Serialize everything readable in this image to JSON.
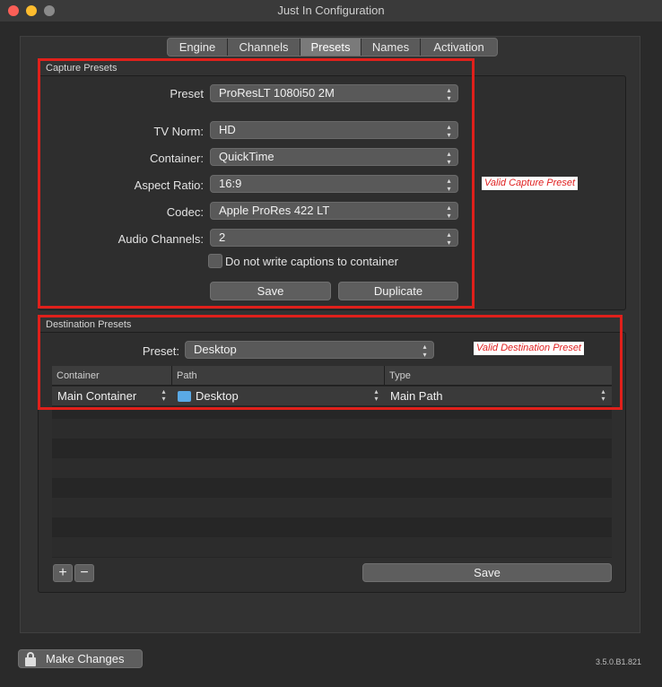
{
  "window": {
    "title": "Just In Configuration",
    "lights": {
      "close": "#fc5f57",
      "minimize": "#fdbc2e",
      "zoom": "#8a8a8a"
    }
  },
  "tabs": [
    {
      "label": "Engine",
      "active": false
    },
    {
      "label": "Channels",
      "active": false
    },
    {
      "label": "Presets",
      "active": true
    },
    {
      "label": "Names",
      "active": false
    },
    {
      "label": "Activation",
      "active": false
    }
  ],
  "capture": {
    "title": "Capture Presets",
    "preset_label": "Preset",
    "preset_value": "ProResLT 1080i50 2M",
    "tvnorm_label": "TV Norm:",
    "tvnorm_value": "HD",
    "container_label": "Container:",
    "container_value": "QuickTime",
    "aspect_label": "Aspect Ratio:",
    "aspect_value": "16:9",
    "codec_label": "Codec:",
    "codec_value": "Apple ProRes 422 LT",
    "audio_label": "Audio Channels:",
    "audio_value": "2",
    "captions_label": "Do not write captions to container",
    "captions_checked": false,
    "save_label": "Save",
    "duplicate_label": "Duplicate",
    "annotation": "Valid Capture Preset"
  },
  "destination": {
    "title": "Destination Presets",
    "preset_label": "Preset:",
    "preset_value": "Desktop",
    "annotation": "Valid Destination Preset",
    "columns": [
      "Container",
      "Path",
      "Type"
    ],
    "row": {
      "container": "Main Container",
      "path": "Desktop",
      "type": "Main Path"
    },
    "add_label": "+",
    "remove_label": "−",
    "save_label": "Save"
  },
  "footer": {
    "make_changes_label": "Make Changes",
    "version": "3.5.0.B1.821"
  },
  "colors": {
    "annotation_red": "#e0201b",
    "folder_blue": "#5aa9e6"
  },
  "icons": {
    "lock": "lock-icon",
    "folder": "folder-icon",
    "popup": "up-down-chevron-icon"
  }
}
